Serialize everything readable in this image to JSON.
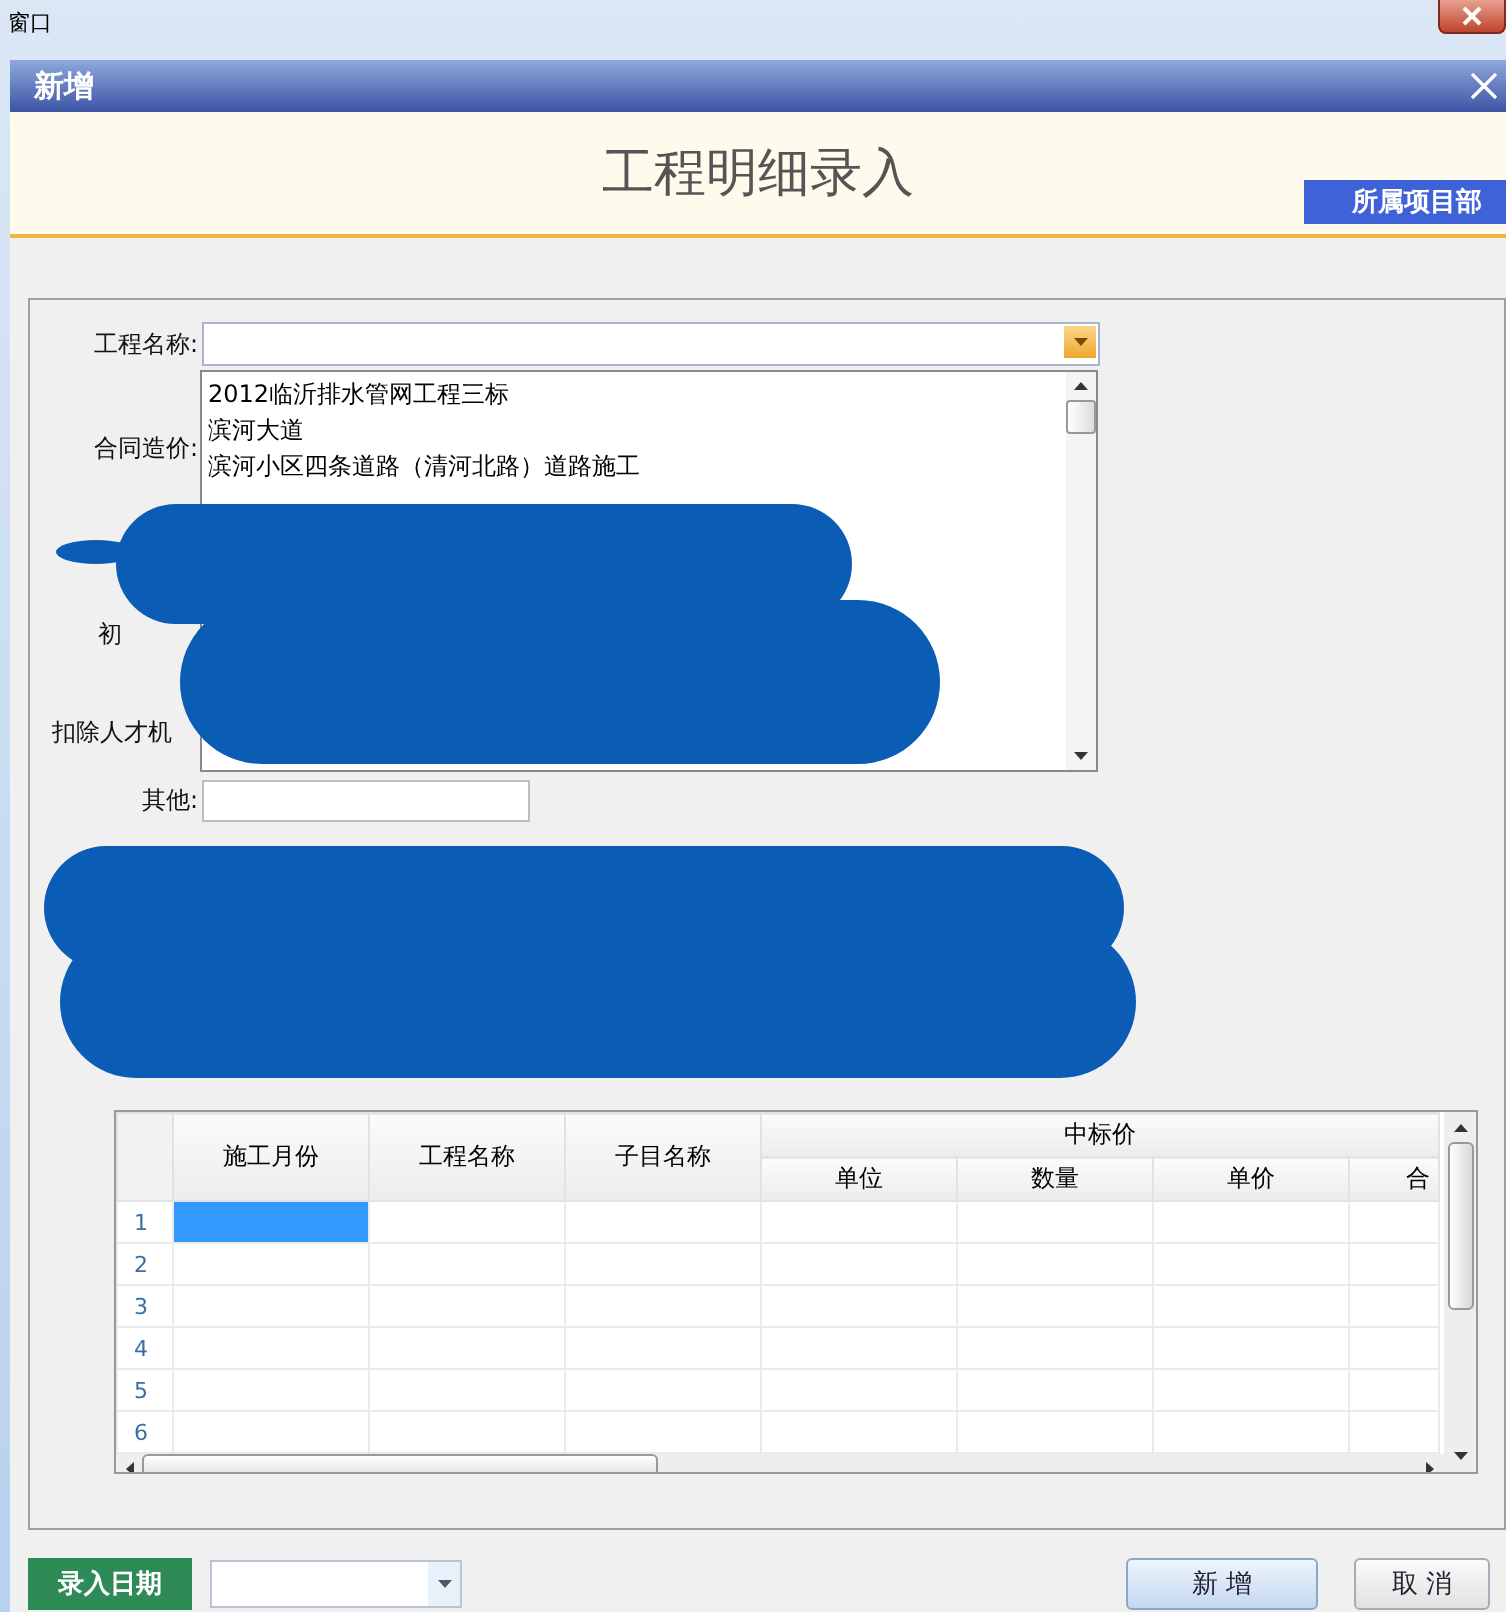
{
  "os_window": {
    "title": "窗口"
  },
  "dialog": {
    "title": "新增",
    "heading": "工程明细录入",
    "tag": "所属项目部"
  },
  "form": {
    "fields": [
      {
        "label": "工程名称:",
        "kind": "combo"
      },
      {
        "label": "合同造价:",
        "kind": "label"
      },
      {
        "label": "初",
        "kind": "partial"
      },
      {
        "label": "扣除人才机",
        "kind": "partial"
      },
      {
        "label": "其他:",
        "kind": "input"
      }
    ],
    "dropdown_items": [
      "2012临沂排水管网工程三标",
      "滨河大道",
      "滨河小区四条道路（清河北路）道路施工"
    ]
  },
  "table": {
    "columns": [
      {
        "label": "施工月份"
      },
      {
        "label": "工程名称"
      },
      {
        "label": "子目名称"
      }
    ],
    "group": {
      "label": "中标价",
      "columns": [
        "单位",
        "数量",
        "单价",
        "合"
      ]
    },
    "rows": [
      {
        "number": "1",
        "selected": true
      },
      {
        "number": "2",
        "selected": false
      },
      {
        "number": "3",
        "selected": false
      },
      {
        "number": "4",
        "selected": false
      },
      {
        "number": "5",
        "selected": false
      },
      {
        "number": "6",
        "selected": false
      }
    ]
  },
  "footer": {
    "date_label": "录入日期",
    "buttons": [
      {
        "label": "新 增",
        "kind": "primary"
      },
      {
        "label": "取 消",
        "kind": "normal"
      }
    ]
  }
}
